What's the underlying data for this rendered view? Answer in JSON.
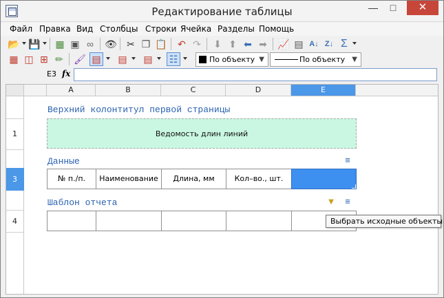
{
  "window": {
    "title": "Редактирование таблицы"
  },
  "menu": [
    "Файл",
    "Правка",
    "Вид",
    "Столбцы",
    "Строки",
    "Ячейка",
    "Разделы",
    "Помощь"
  ],
  "toolbar2": {
    "fill_combo": "По объекту",
    "line_combo": "По объекту"
  },
  "formula": {
    "cell_ref": "E3",
    "fx": "fx",
    "value": ""
  },
  "columns": [
    "A",
    "B",
    "C",
    "D",
    "E"
  ],
  "rows": {
    "r1": "1",
    "r3": "3",
    "r4": "4"
  },
  "sections": {
    "page_header_title": "Верхний колонтитул первой страницы",
    "page_header_content": "Ведомость длин линий",
    "data_title": "Данные",
    "template_title": "Шаблон отчета"
  },
  "data_row": [
    "№ п./п.",
    "Наименование",
    "Длина, мм",
    "Кол–во., шт.",
    ""
  ],
  "template_row": [
    "",
    "",
    "",
    "",
    ""
  ],
  "tooltip": "Выбрать исходные объекты",
  "colors": {
    "selection": "#3d8ff0",
    "header_band": "#c9f7e2",
    "section_title": "#2b62b0"
  }
}
